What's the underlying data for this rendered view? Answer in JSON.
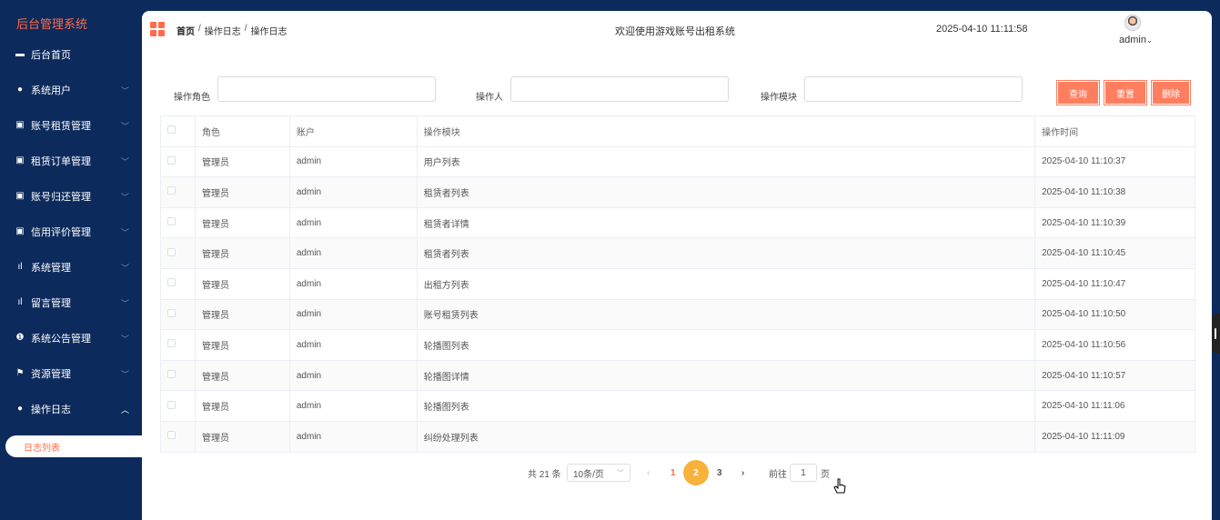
{
  "sidebar": {
    "brand": "后台管理系统",
    "items": [
      {
        "label": "后台首页",
        "icon": "monitor-icon",
        "has_chevron": false
      },
      {
        "label": "系统用户",
        "icon": "user-icon",
        "has_chevron": true
      },
      {
        "label": "账号租赁管理",
        "icon": "chart-box-icon",
        "has_chevron": true
      },
      {
        "label": "租赁订单管理",
        "icon": "chart-box-icon",
        "has_chevron": true
      },
      {
        "label": "账号归还管理",
        "icon": "chart-box-icon",
        "has_chevron": true
      },
      {
        "label": "信用评价管理",
        "icon": "chart-box-icon",
        "has_chevron": true
      },
      {
        "label": "系统管理",
        "icon": "bar-chart-icon",
        "has_chevron": true
      },
      {
        "label": "留言管理",
        "icon": "bar-chart-icon",
        "has_chevron": true
      },
      {
        "label": "系统公告管理",
        "icon": "info-icon",
        "has_chevron": true
      },
      {
        "label": "资源管理",
        "icon": "flag-icon",
        "has_chevron": true
      },
      {
        "label": "操作日志",
        "icon": "user-icon",
        "has_chevron": true,
        "expanded": true
      }
    ],
    "submenu": {
      "label": "日志列表"
    }
  },
  "header": {
    "breadcrumb": [
      "首页",
      "操作日志",
      "操作日志"
    ],
    "breadcrumb_sep": "/",
    "welcome": "欢迎使用游戏账号出租系统",
    "datetime": "2025-04-10 11:11:58",
    "username": "admin",
    "caret": "⌄"
  },
  "search": {
    "role_label": "操作角色",
    "operator_label": "操作人",
    "module_label": "操作模块",
    "role_value": "",
    "operator_value": "",
    "module_value": "",
    "query_button": "查询",
    "reset_button": "重置",
    "delete_button": "删除"
  },
  "table": {
    "columns": [
      "角色",
      "账户",
      "操作模块",
      "操作时间"
    ],
    "rows": [
      [
        "管理员",
        "admin",
        "用户列表",
        "2025-04-10 11:10:37"
      ],
      [
        "管理员",
        "admin",
        "租赁者列表",
        "2025-04-10 11:10:38"
      ],
      [
        "管理员",
        "admin",
        "租赁者详情",
        "2025-04-10 11:10:39"
      ],
      [
        "管理员",
        "admin",
        "租赁者列表",
        "2025-04-10 11:10:45"
      ],
      [
        "管理员",
        "admin",
        "出租方列表",
        "2025-04-10 11:10:47"
      ],
      [
        "管理员",
        "admin",
        "账号租赁列表",
        "2025-04-10 11:10:50"
      ],
      [
        "管理员",
        "admin",
        "轮播图列表",
        "2025-04-10 11:10:56"
      ],
      [
        "管理员",
        "admin",
        "轮播图详情",
        "2025-04-10 11:10:57"
      ],
      [
        "管理员",
        "admin",
        "轮播图列表",
        "2025-04-10 11:11:06"
      ],
      [
        "管理员",
        "admin",
        "纠纷处理列表",
        "2025-04-10 11:11:09"
      ]
    ]
  },
  "pagination": {
    "total": "共 21 条",
    "page_size": "10条/页",
    "prev": "‹",
    "pages": [
      "1",
      "2",
      "3"
    ],
    "current_page": "1",
    "next": "›",
    "goto_label": "前往",
    "goto_value": "1",
    "page_suffix": "页"
  },
  "colors": {
    "sidebar_bg": "#0c2a5c",
    "accent": "#ff6b4a",
    "button": "#ff7e5f",
    "page_hover": "#f7b23b"
  }
}
